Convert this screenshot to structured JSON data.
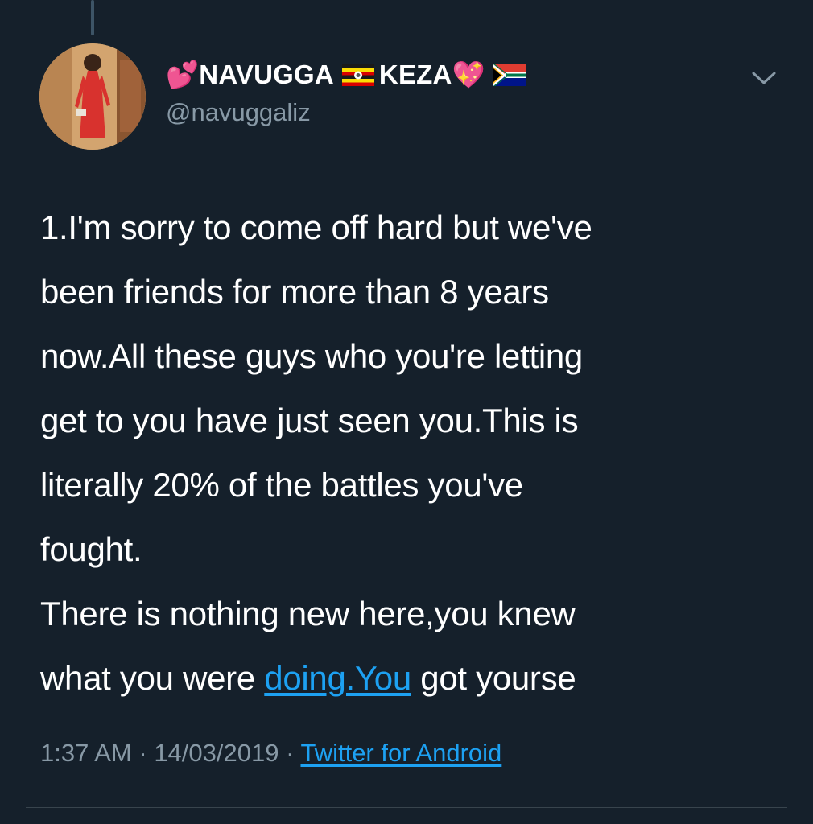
{
  "author": {
    "emoji_before": "💕",
    "name_part1": "NAVUGGA",
    "name_part2": "KEZA",
    "emoji_after": "💖",
    "handle": "@navuggaliz"
  },
  "tweet": {
    "line1": "1.I'm sorry to come off hard but we've",
    "line2": "been friends for more than 8 years",
    "line3": "now.All these guys who you're letting",
    "line4": "get to you have just seen you.This is",
    "line5": "literally 20% of the battles you've",
    "line6": "fought.",
    "line7": "There is nothing new here,you knew",
    "line8_prefix": "what you were ",
    "line8_link": "doing.You",
    "line8_suffix": " got yourse"
  },
  "meta": {
    "time": "1:37 AM",
    "separator": " · ",
    "date": "14/03/2019",
    "source": "Twitter for Android"
  },
  "colors": {
    "background": "#15202b",
    "secondary_text": "#8899a6",
    "link": "#1da1f2"
  },
  "icons": {
    "menu": "chevron-down-icon",
    "flag1": "uganda-flag-icon",
    "flag2": "south-africa-flag-icon"
  }
}
